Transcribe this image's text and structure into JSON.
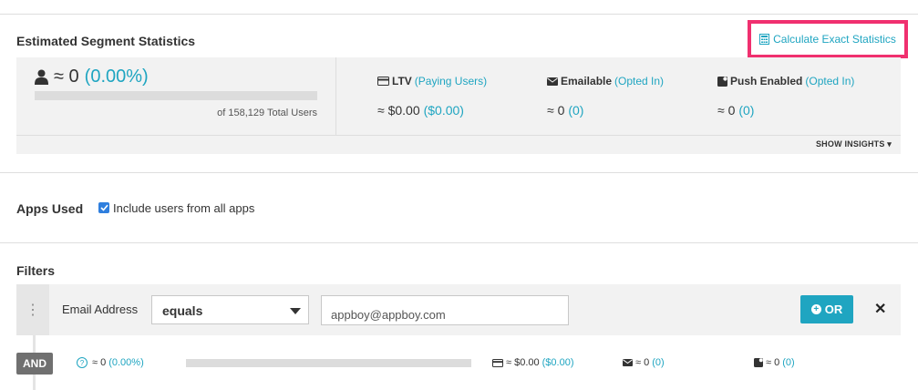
{
  "segment_stats": {
    "title": "Estimated Segment Statistics",
    "calculate_link": "Calculate Exact Statistics",
    "approx_count": "≈ 0",
    "percent": "(0.00%)",
    "progress_fraction": 0,
    "total_users": "of 158,129 Total Users",
    "metrics": [
      {
        "icon": "credit-card-icon",
        "label": "LTV",
        "sub": "(Paying Users)",
        "value": "≈ $0.00",
        "value_sub": "($0.00)"
      },
      {
        "icon": "envelope-icon",
        "label": "Emailable",
        "sub": "(Opted In)",
        "value": "≈ 0",
        "value_sub": "(0)"
      },
      {
        "icon": "push-icon",
        "label": "Push Enabled",
        "sub": "(Opted In)",
        "value": "≈ 0",
        "value_sub": "(0)"
      }
    ],
    "show_insights": "SHOW INSIGHTS"
  },
  "apps": {
    "label": "Apps Used",
    "include_all_label": "Include users from all apps",
    "include_all_checked": true
  },
  "filters": {
    "title": "Filters",
    "rows": [
      {
        "field": "Email Address",
        "operator": "equals",
        "value": "appboy@appboy.com",
        "or_label": "OR",
        "stats": {
          "connector": "AND",
          "count": "≈ 0",
          "percent": "(0.00%)",
          "ltv": "≈ $0.00",
          "ltv_sub": "($0.00)",
          "emailable": "≈ 0",
          "emailable_sub": "(0)",
          "push": "≈ 0",
          "push_sub": "(0)"
        }
      }
    ]
  },
  "colors": {
    "accent": "#1fa5c1",
    "highlight": "#f0306f",
    "checkbox": "#2f7fde"
  }
}
